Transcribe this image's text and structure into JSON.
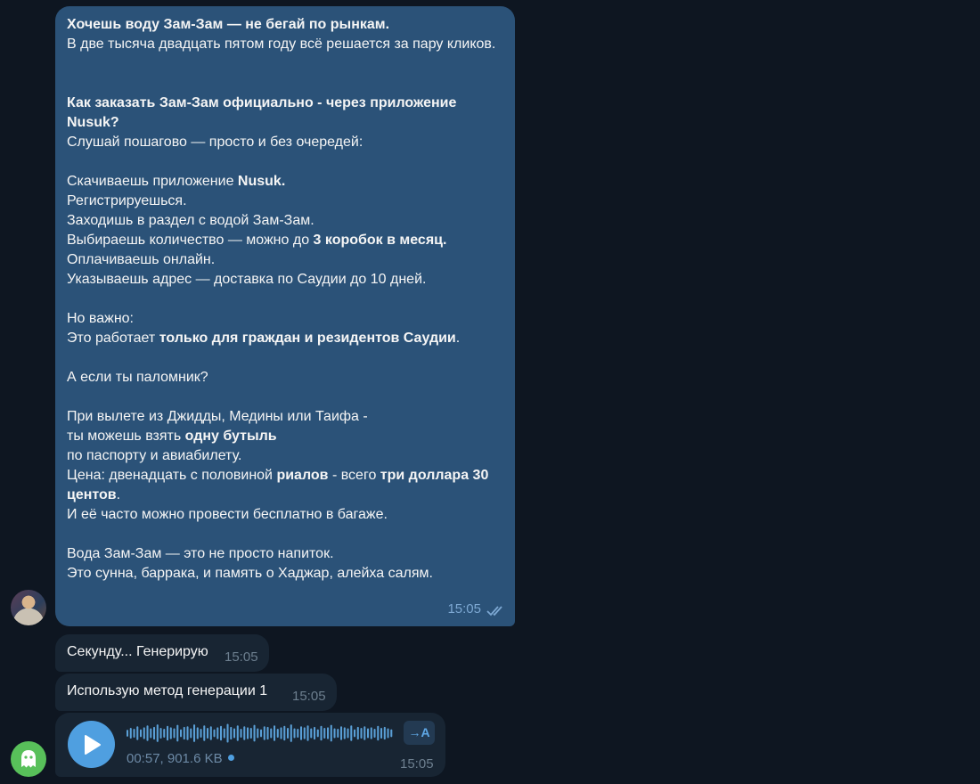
{
  "long_message": {
    "lines": [
      [
        {
          "t": "Хочешь воду Зам-Зам — не бегай по рынкам.",
          "b": true
        }
      ],
      [
        {
          "t": "В две тысяча двадцать пятом году всё решается за пару кликов."
        }
      ],
      [],
      [],
      [
        {
          "t": "Как заказать Зам-Зам официально - через приложение Nusuk?",
          "b": true
        }
      ],
      [
        {
          "t": "Слушай пошагово — просто и без очередей:"
        }
      ],
      [],
      [
        {
          "t": "Скачиваешь приложение "
        },
        {
          "t": "Nusuk.",
          "b": true
        }
      ],
      [
        {
          "t": "Регистрируешься."
        }
      ],
      [
        {
          "t": "Заходишь в раздел с водой Зам-Зам."
        }
      ],
      [
        {
          "t": "Выбираешь количество — можно до "
        },
        {
          "t": "3 коробок в месяц.",
          "b": true
        }
      ],
      [
        {
          "t": "Оплачиваешь онлайн."
        }
      ],
      [
        {
          "t": "Указываешь адрес — доставка по Саудии до 10 дней."
        }
      ],
      [],
      [
        {
          "t": "Но важно:"
        }
      ],
      [
        {
          "t": "Это работает "
        },
        {
          "t": "только для граждан и резидентов Саудии",
          "b": true
        },
        {
          "t": "."
        }
      ],
      [],
      [
        {
          "t": "А если ты паломник?"
        }
      ],
      [],
      [
        {
          "t": "При вылете из Джидды, Медины или Таифа -"
        }
      ],
      [
        {
          "t": "ты можешь взять "
        },
        {
          "t": "одну бутыль",
          "b": true
        }
      ],
      [
        {
          "t": "по паспорту и авиабилету."
        }
      ],
      [
        {
          "t": "Цена: двенадцать с половиной "
        },
        {
          "t": "риалов",
          "b": true
        },
        {
          "t": " - всего "
        },
        {
          "t": "три доллара 30 центов",
          "b": true
        },
        {
          "t": "."
        }
      ],
      [
        {
          "t": "И её часто можно провести бесплатно в багаже."
        }
      ],
      [],
      [
        {
          "t": "Вода Зам-Зам — это не просто напиток."
        }
      ],
      [
        {
          "t": "Это сунна, баррака, и память о Хаджар, алейха салям."
        }
      ]
    ],
    "time": "15:05",
    "status": "read"
  },
  "message_second": {
    "text": "Секунду... Генерирую",
    "time": "15:05"
  },
  "message_method": {
    "text": "Использую метод генерации 1",
    "time": "15:05"
  },
  "voice_message": {
    "meta": "00:57, 901.6 KB",
    "time": "15:05",
    "transcribe_label": "→A",
    "waveform_levels": [
      0.35,
      0.55,
      0.45,
      0.7,
      0.4,
      0.6,
      0.8,
      0.5,
      0.65,
      0.9,
      0.55,
      0.45,
      0.75,
      0.6,
      0.5,
      0.85,
      0.4,
      0.65,
      0.7,
      0.5,
      0.9,
      0.6,
      0.45,
      0.8,
      0.55,
      0.7,
      0.4,
      0.6,
      0.75,
      0.5,
      0.95,
      0.65,
      0.5,
      0.8,
      0.45,
      0.7,
      0.6,
      0.55,
      0.85,
      0.5,
      0.4,
      0.7,
      0.65,
      0.5,
      0.8,
      0.45,
      0.6,
      0.75,
      0.55,
      0.9,
      0.5,
      0.45,
      0.7,
      0.6,
      0.8,
      0.5,
      0.65,
      0.4,
      0.75,
      0.55,
      0.6,
      0.85,
      0.5,
      0.45,
      0.7,
      0.6,
      0.5,
      0.8,
      0.4,
      0.65,
      0.55,
      0.7,
      0.5,
      0.6,
      0.45,
      0.75,
      0.55,
      0.65,
      0.5,
      0.4
    ]
  },
  "colors": {
    "chat_bg": "#0e1621",
    "outgoing": "#2b5278",
    "incoming": "#182533",
    "accent": "#4f9fe0",
    "bot_avatar": "#58c05a"
  },
  "icons": {
    "play": "play-icon",
    "checks": "double-check-icon",
    "bot": "ghost-icon"
  }
}
